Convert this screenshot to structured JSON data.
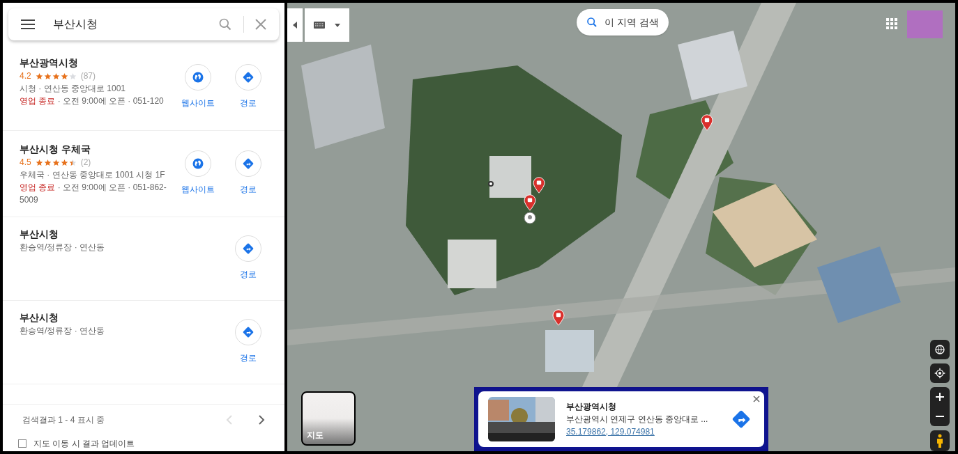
{
  "search": {
    "value": "부산시청"
  },
  "results": [
    {
      "title": "부산광역시청",
      "rating": "4.2",
      "stars": 4,
      "reviews": "(87)",
      "category": "시청 · 연산동 중앙대로 1001",
      "status": "영업 종료",
      "hours": " · 오전 9:00에 오픈 · 051-120",
      "actions": [
        {
          "kind": "website",
          "label": "웹사이트"
        },
        {
          "kind": "directions",
          "label": "경로"
        }
      ]
    },
    {
      "title": "부산시청 우체국",
      "rating": "4.5",
      "stars": 4.5,
      "reviews": "(2)",
      "category": "우체국 · 연산동 중앙대로 1001 시청 1F",
      "status": "영업 종료",
      "hours": " · 오전 9:00에 오픈 · 051-862-5009",
      "actions": [
        {
          "kind": "website",
          "label": "웹사이트"
        },
        {
          "kind": "directions",
          "label": "경로"
        }
      ]
    },
    {
      "title": "부산시청",
      "category": "환승역/정류장 · 연산동",
      "actions": [
        {
          "kind": "directions",
          "label": "경로"
        }
      ]
    },
    {
      "title": "부산시청",
      "category": "환승역/정류장 · 연산동",
      "actions": [
        {
          "kind": "directions",
          "label": "경로"
        }
      ]
    }
  ],
  "pagination": {
    "summary": "검색결과 1 - 4 표시 중",
    "prev_disabled": true,
    "next_disabled": false
  },
  "update_on_move": {
    "label": "지도 이동 시 결과 업데이트",
    "checked": false
  },
  "map": {
    "search_area_button": "이 지역 검색",
    "layer_tile": "지도",
    "info_card": {
      "title": "부산광역시청",
      "address": "부산광역시 연제구 연산동 중앙대로 ...",
      "coords": "35.179862, 129.074981"
    }
  }
}
